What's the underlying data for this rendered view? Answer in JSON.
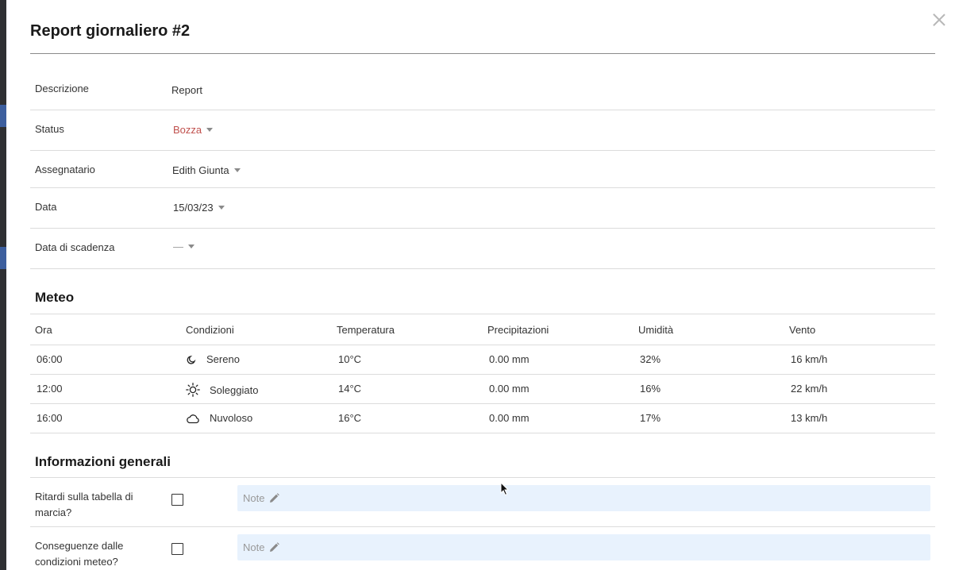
{
  "dialog": {
    "title": "Report giornaliero #2"
  },
  "fields": {
    "descrizione": {
      "label": "Descrizione",
      "value": "Report"
    },
    "status": {
      "label": "Status",
      "value": "Bozza",
      "color": "#c0504d"
    },
    "assegnatario": {
      "label": "Assegnatario",
      "value": "Edith Giunta"
    },
    "data": {
      "label": "Data",
      "value": "15/03/23"
    },
    "scadenza": {
      "label": "Data di scadenza",
      "value": "—"
    }
  },
  "meteo": {
    "title": "Meteo",
    "headers": [
      "Ora",
      "Condizioni",
      "Temperatura",
      "Precipitazioni",
      "Umidità",
      "Vento"
    ],
    "rows": [
      {
        "ora": "06:00",
        "icon": "moon-icon",
        "condizioni": "Sereno",
        "temperatura": "10°C",
        "precipitazioni": "0.00 mm",
        "umidita": "32%",
        "vento": "16 km/h"
      },
      {
        "ora": "12:00",
        "icon": "sun-icon",
        "condizioni": "Soleggiato",
        "temperatura": "14°C",
        "precipitazioni": "0.00 mm",
        "umidita": "16%",
        "vento": "22 km/h"
      },
      {
        "ora": "16:00",
        "icon": "cloud-icon",
        "condizioni": "Nuvoloso",
        "temperatura": "16°C",
        "precipitazioni": "0.00 mm",
        "umidita": "17%",
        "vento": "13 km/h"
      }
    ]
  },
  "info": {
    "title": "Informazioni generali",
    "items": [
      {
        "label": "Ritardi sulla tabella di marcia?",
        "checked": false,
        "note_placeholder": "Note"
      },
      {
        "label": "Conseguenze dalle condizioni meteo?",
        "checked": false,
        "note_placeholder": "Note"
      }
    ]
  },
  "colors": {
    "accent_red": "#c0504d",
    "note_bg": "#e8f2fd"
  }
}
